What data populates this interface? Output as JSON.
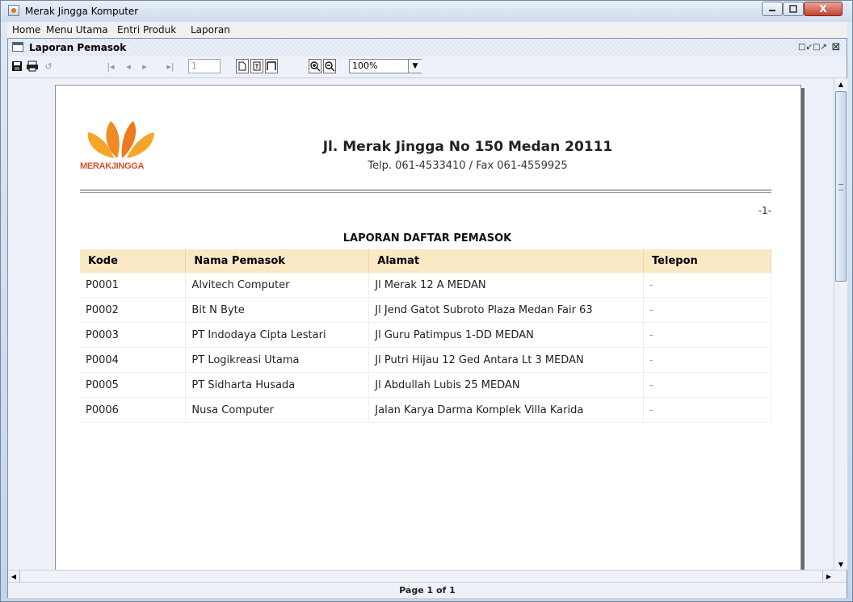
{
  "window": {
    "title": "Merak Jingga Komputer",
    "close_label": "X"
  },
  "menubar": {
    "items": [
      "Home",
      "Menu Utama",
      "Entri Produk",
      "Laporan"
    ]
  },
  "internal_frame": {
    "title": "Laporan Pemasok"
  },
  "toolbar": {
    "page_value": "1",
    "zoom_value": "100%"
  },
  "report": {
    "logo_text": "MERAKJINGGA",
    "company_address": "Jl. Merak Jingga No 150 Medan 20111",
    "company_contact": "Telp. 061-4533410 / Fax 061-4559925",
    "page_number": "-1-",
    "title": "LAPORAN DAFTAR PEMASOK",
    "columns": [
      "Kode",
      "Nama Pemasok",
      "Alamat",
      "Telepon"
    ],
    "rows": [
      [
        "P0001",
        "Alvitech Computer",
        "Jl Merak 12 A MEDAN",
        "-"
      ],
      [
        "P0002",
        "Bit N Byte",
        "Jl Jend Gatot Subroto Plaza Medan Fair 63",
        "-"
      ],
      [
        "P0003",
        "PT Indodaya Cipta Lestari",
        "Jl Guru Patimpus 1-DD MEDAN",
        "-"
      ],
      [
        "P0004",
        "PT Logikreasi Utama",
        "Jl Putri Hijau 12 Ged Antara Lt 3 MEDAN",
        "-"
      ],
      [
        "P0005",
        "PT Sidharta Husada",
        "Jl Abdullah Lubis 25 MEDAN",
        "-"
      ],
      [
        "P0006",
        "Nusa Computer",
        "Jalan Karya Darma Komplek Villa Karida",
        "-"
      ]
    ]
  },
  "status": {
    "page_text": "Page 1 of 1"
  },
  "colors": {
    "header_row": "#fbe8c4",
    "logo_orange": "#f08a24",
    "logo_text": "#d8532c"
  }
}
